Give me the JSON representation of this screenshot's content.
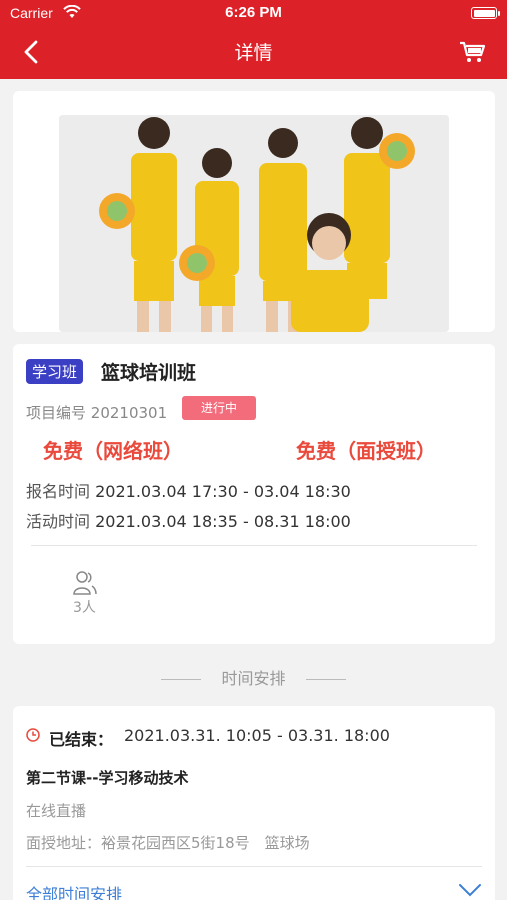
{
  "status_bar": {
    "carrier": "Carrier",
    "time": "6:26 PM"
  },
  "nav": {
    "title": "详情",
    "back_icon": "back-arrow-icon",
    "cart_icon": "cart-icon"
  },
  "course": {
    "tag": "学习班",
    "title": "篮球培训班",
    "code_label": "项目编号",
    "code": "20210301",
    "status": "进行中",
    "price_online": "免费（网络班）",
    "price_offline": "免费（面授班）",
    "signup_label": "报名时间",
    "signup_time": "2021.03.04 17:30 - 03.04 18:30",
    "activity_label": "活动时间",
    "activity_time": "2021.03.04 18:35 - 08.31 18:00",
    "people": "3人"
  },
  "schedule": {
    "section_title": "时间安排",
    "ended_label": "已结束：",
    "time_range": "2021.03.31. 10:05 - 03.31. 18:00",
    "lesson": "第二节课--学习移动技术",
    "mode": "在线直播",
    "address": "面授地址：裕景花园西区5街18号　篮球场",
    "all_link": "全部时间安排"
  },
  "colors": {
    "brand": "#dc2128",
    "tag": "#3b3fc4",
    "price": "#e94a3c",
    "badge": "#f26c7c",
    "link": "#3d7fd6"
  }
}
